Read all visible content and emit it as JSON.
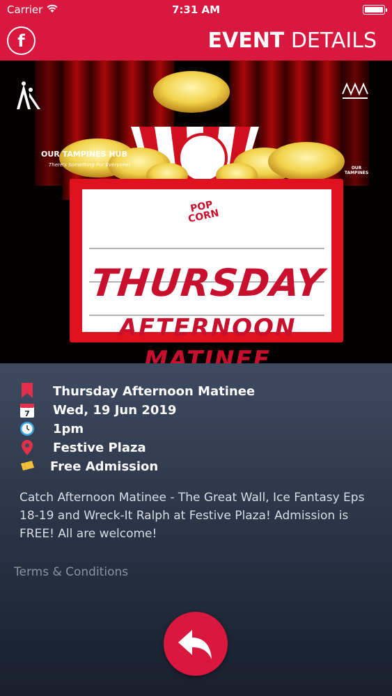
{
  "status_bar": {
    "carrier": "Carrier",
    "time": "7:31 AM"
  },
  "nav": {
    "facebook_glyph": "f",
    "title_bold": "EVENT",
    "title_light": "DETAILS"
  },
  "poster": {
    "hub_name": "OUR TAMPINES HUB",
    "hub_tagline": "There's Something For Everyone!",
    "ot_name": "OUR TAMPINES",
    "popcorn_label": "POP CORN",
    "headline": "THURSDAY",
    "subline_1": "AFTERNOON",
    "subline_2": "MATINEE"
  },
  "event": {
    "title": "Thursday Afternoon Matinee",
    "date": "Wed, 19 Jun 2019",
    "calendar_day": "7",
    "time": "1pm",
    "location": "Festive Plaza",
    "admission": "Free Admission",
    "description": "Catch Afternoon Matinee - The Great Wall, Ice Fantasy Eps 18-19 and Wreck-It Ralph at Festive Plaza! Admission is FREE! All are welcome!",
    "terms": "Terms & Conditions"
  },
  "colors": {
    "brand_red": "#d9183f",
    "info_bg_top": "#3d4a60",
    "info_bg_bottom": "#1a202c"
  },
  "icons": {
    "title": "bookmark-icon",
    "date": "calendar-icon",
    "time": "clock-icon",
    "location": "map-pin-icon",
    "admission": "ticket-icon",
    "back": "back-arrow-icon"
  }
}
